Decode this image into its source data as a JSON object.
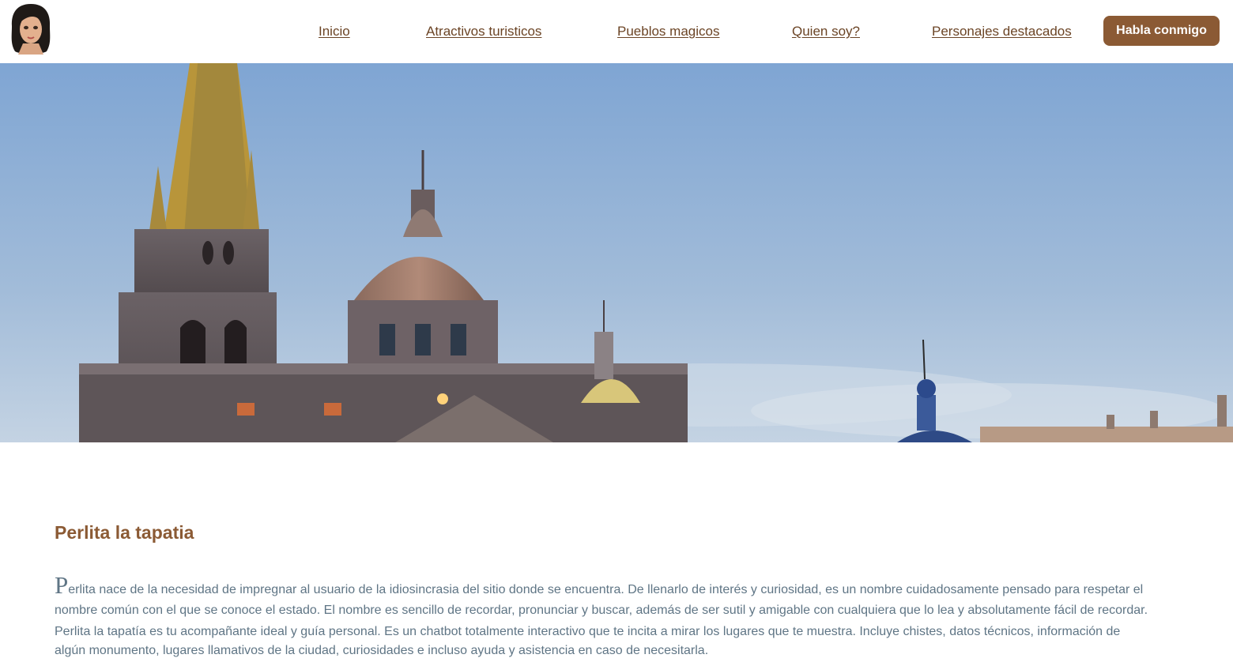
{
  "header": {
    "avatar_icon": "avatar-woman-icon",
    "nav": [
      {
        "label": "Inicio"
      },
      {
        "label": "Atractivos turisticos"
      },
      {
        "label": "Pueblos magicos"
      },
      {
        "label": "Quien soy?"
      },
      {
        "label": "Personajes destacados"
      }
    ],
    "cta_label": "Habla conmigo"
  },
  "hero": {
    "image_icon": "cathedral-photo"
  },
  "content": {
    "title": "Perlita la tapatia",
    "dropcap": "P",
    "lines": [
      "erlita nace de la necesidad de impregnar al usuario de la idiosincrasia del sitio donde se encuentra. De llenarlo de interés y curiosidad, es un nombre cuidadosamente pensado para respetar el",
      "nombre común con el que se conoce el estado. El nombre es sencillo de recordar, pronunciar y buscar, además de ser sutil y amigable con cualquiera que lo lea y absolutamente fácil de recordar.",
      "Perlita la tapatía es tu acompañante ideal y guía personal. Es un chatbot totalmente interactivo que te incita a mirar los lugares que te muestra. Incluye chistes, datos técnicos, información de",
      "algún monumento, lugares llamativos de la ciudad, curiosidades e incluso ayuda y asistencia en caso de necesitarla."
    ]
  },
  "colors": {
    "accent": "#8b5a34",
    "nav_text": "#6b4425",
    "body_text": "#5f7585",
    "sky": "#8fb0d6"
  }
}
